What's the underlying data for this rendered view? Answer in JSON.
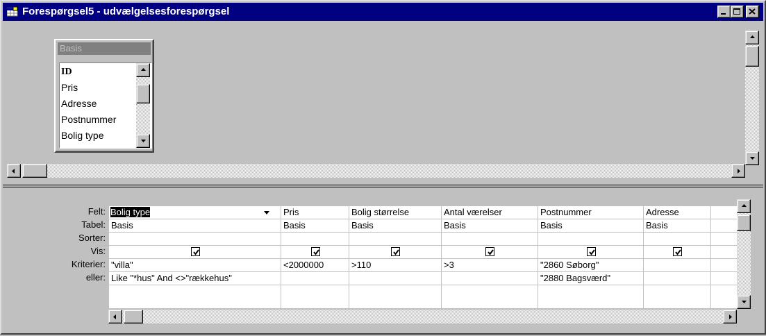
{
  "window": {
    "title": "Forespørgsel5 - udvælgelsesforespørgsel"
  },
  "table_box": {
    "title": "Basis",
    "fields": [
      "ID",
      "Pris",
      "Adresse",
      "Postnummer",
      "Bolig type"
    ]
  },
  "grid": {
    "row_labels": {
      "field": "Felt:",
      "table": "Tabel:",
      "sort": "Sorter:",
      "show": "Vis:",
      "criteria": "Kriterier:",
      "or": "eller:"
    },
    "columns": [
      {
        "field": "Bolig type",
        "table": "Basis",
        "sort": "",
        "show": true,
        "criteria": "\"villa\"",
        "or": "Like \"*hus\" And <>\"rækkehus\""
      },
      {
        "field": "Pris",
        "table": "Basis",
        "sort": "",
        "show": true,
        "criteria": "<2000000",
        "or": ""
      },
      {
        "field": "Bolig størrelse",
        "table": "Basis",
        "sort": "",
        "show": true,
        "criteria": ">110",
        "or": ""
      },
      {
        "field": "Antal værelser",
        "table": "Basis",
        "sort": "",
        "show": true,
        "criteria": ">3",
        "or": ""
      },
      {
        "field": "Postnummer",
        "table": "Basis",
        "sort": "",
        "show": true,
        "criteria": "\"2860 Søborg\"",
        "or": "\"2880 Bagsværd\""
      },
      {
        "field": "Adresse",
        "table": "Basis",
        "sort": "",
        "show": true,
        "criteria": "",
        "or": ""
      },
      {
        "field": "",
        "table": "",
        "sort": "",
        "show": false,
        "criteria": "",
        "or": ""
      }
    ]
  },
  "icons": {
    "title": "query-window-icon",
    "minimize": "minimize-icon",
    "maximize": "maximize-icon",
    "close": "close-icon",
    "dropdown": "dropdown-arrow-icon"
  },
  "colors": {
    "titlebar": "#000080",
    "face": "#c0c0c0",
    "grid_background": "#ffffff"
  }
}
